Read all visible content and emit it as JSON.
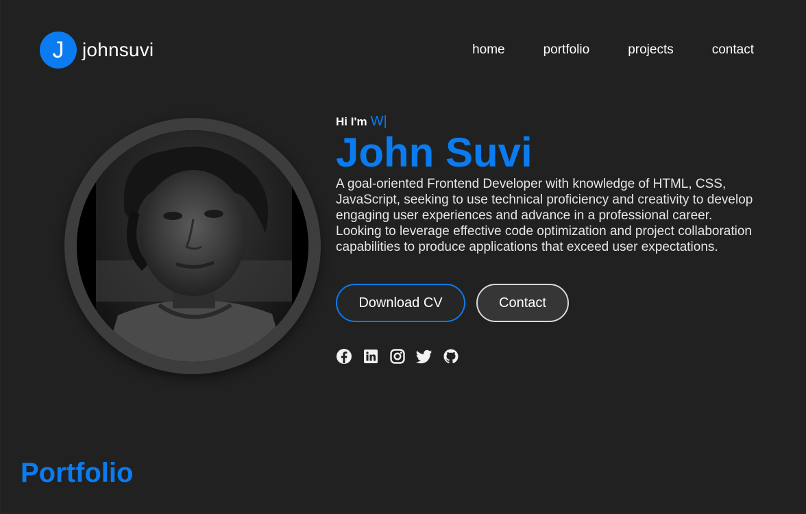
{
  "header": {
    "logo_letter": "J",
    "brand": "johnsuvi",
    "nav": [
      {
        "label": "home"
      },
      {
        "label": "portfolio"
      },
      {
        "label": "projects"
      },
      {
        "label": "contact"
      }
    ]
  },
  "hero": {
    "greeting": "Hi I'm",
    "typed_text": "W|",
    "name": "John Suvi",
    "bio": "A goal-oriented Frontend Developer with knowledge of HTML, CSS, JavaScript, seeking to use technical proficiency and creativity to develop engaging user experiences and advance in a professional career. Looking to leverage effective code optimization and project collaboration capabilities to produce applications that exceed user expectations.",
    "download_label": "Download CV",
    "contact_label": "Contact"
  },
  "socials": [
    "facebook-icon",
    "linkedin-icon",
    "instagram-icon",
    "twitter-icon",
    "github-icon"
  ],
  "sections": {
    "portfolio_title": "Portfolio"
  },
  "colors": {
    "accent": "#0a7cf0",
    "background": "#212121"
  }
}
